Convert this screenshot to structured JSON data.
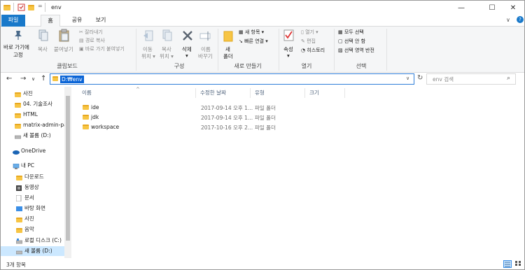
{
  "window": {
    "title": "env",
    "minimize_glyph": "—",
    "maximize_glyph": "☐",
    "close_glyph": "✕",
    "qa_dropdown": "="
  },
  "tabs": [
    "파일",
    "홈",
    "공유",
    "보기"
  ],
  "ribbon": {
    "clipboard": {
      "pin_label_1": "바로 가기에",
      "pin_label_2": "고정",
      "copy": "복사",
      "paste": "붙여넣기",
      "cut": "잘라내기",
      "copy_path": "경로 복사",
      "paste_shortcut": "바로 가기 붙여넣기",
      "group": "클립보드"
    },
    "organize": {
      "move_1": "이동",
      "move_2": "위치 ▾",
      "copyto_1": "복사",
      "copyto_2": "위치 ▾",
      "delete": "삭제",
      "delete_2": "▾",
      "rename_1": "이름",
      "rename_2": "바꾸기",
      "group": "구성"
    },
    "new": {
      "folder_1": "새",
      "folder_2": "폴더",
      "new_item": "새 항목 ▾",
      "easy_access": "빠른 연결 ▾",
      "group": "새로 만들기"
    },
    "open": {
      "properties": "속성",
      "properties_2": "▾",
      "open": "열기 ▾",
      "edit": "편집",
      "history": "히스토리",
      "group": "열기"
    },
    "select": {
      "select_all": "모두 선택",
      "select_none": "선택 안 함",
      "invert": "선택 영역 반전",
      "group": "선택"
    },
    "expand_glyph": "∨",
    "help_glyph": "?"
  },
  "address": {
    "path": "D:₩env",
    "search_placeholder": "env 검색",
    "back": "←",
    "forward": "→",
    "recent": "∨",
    "up": "↑",
    "dropdown": "∨",
    "refresh": "↻",
    "search_glyph": "⌕"
  },
  "nav": {
    "items": [
      {
        "label": "사진"
      },
      {
        "label": "04. 기술조사"
      },
      {
        "label": "HTML"
      },
      {
        "label": "matrix-admin-pa"
      },
      {
        "label": "새 볼륨 (D:)"
      },
      {
        "label": "OneDrive"
      },
      {
        "label": "내 PC"
      },
      {
        "label": "다운로드"
      },
      {
        "label": "동영상"
      },
      {
        "label": "문서"
      },
      {
        "label": "바탕 화면"
      },
      {
        "label": "사진"
      },
      {
        "label": "음악"
      },
      {
        "label": "로컬 디스크 (C:)"
      },
      {
        "label": "새 볼륨 (D:)"
      }
    ]
  },
  "list": {
    "columns": [
      "이름",
      "수정한 날짜",
      "유형",
      "크기"
    ],
    "sort_glyph": "^",
    "rows": [
      {
        "name": "ide",
        "date": "2017-09-14 오후 1...",
        "type": "파일 폴더"
      },
      {
        "name": "jdk",
        "date": "2017-09-14 오후 1...",
        "type": "파일 폴더"
      },
      {
        "name": "workspace",
        "date": "2017-10-16 오후 2...",
        "type": "파일 폴더"
      }
    ]
  },
  "status": {
    "count": "3개 항목"
  },
  "colors": {
    "accent": "#1979ca",
    "selection": "#0a64d6",
    "nav_selected": "#cce8ff",
    "folder": "#f7c544"
  }
}
